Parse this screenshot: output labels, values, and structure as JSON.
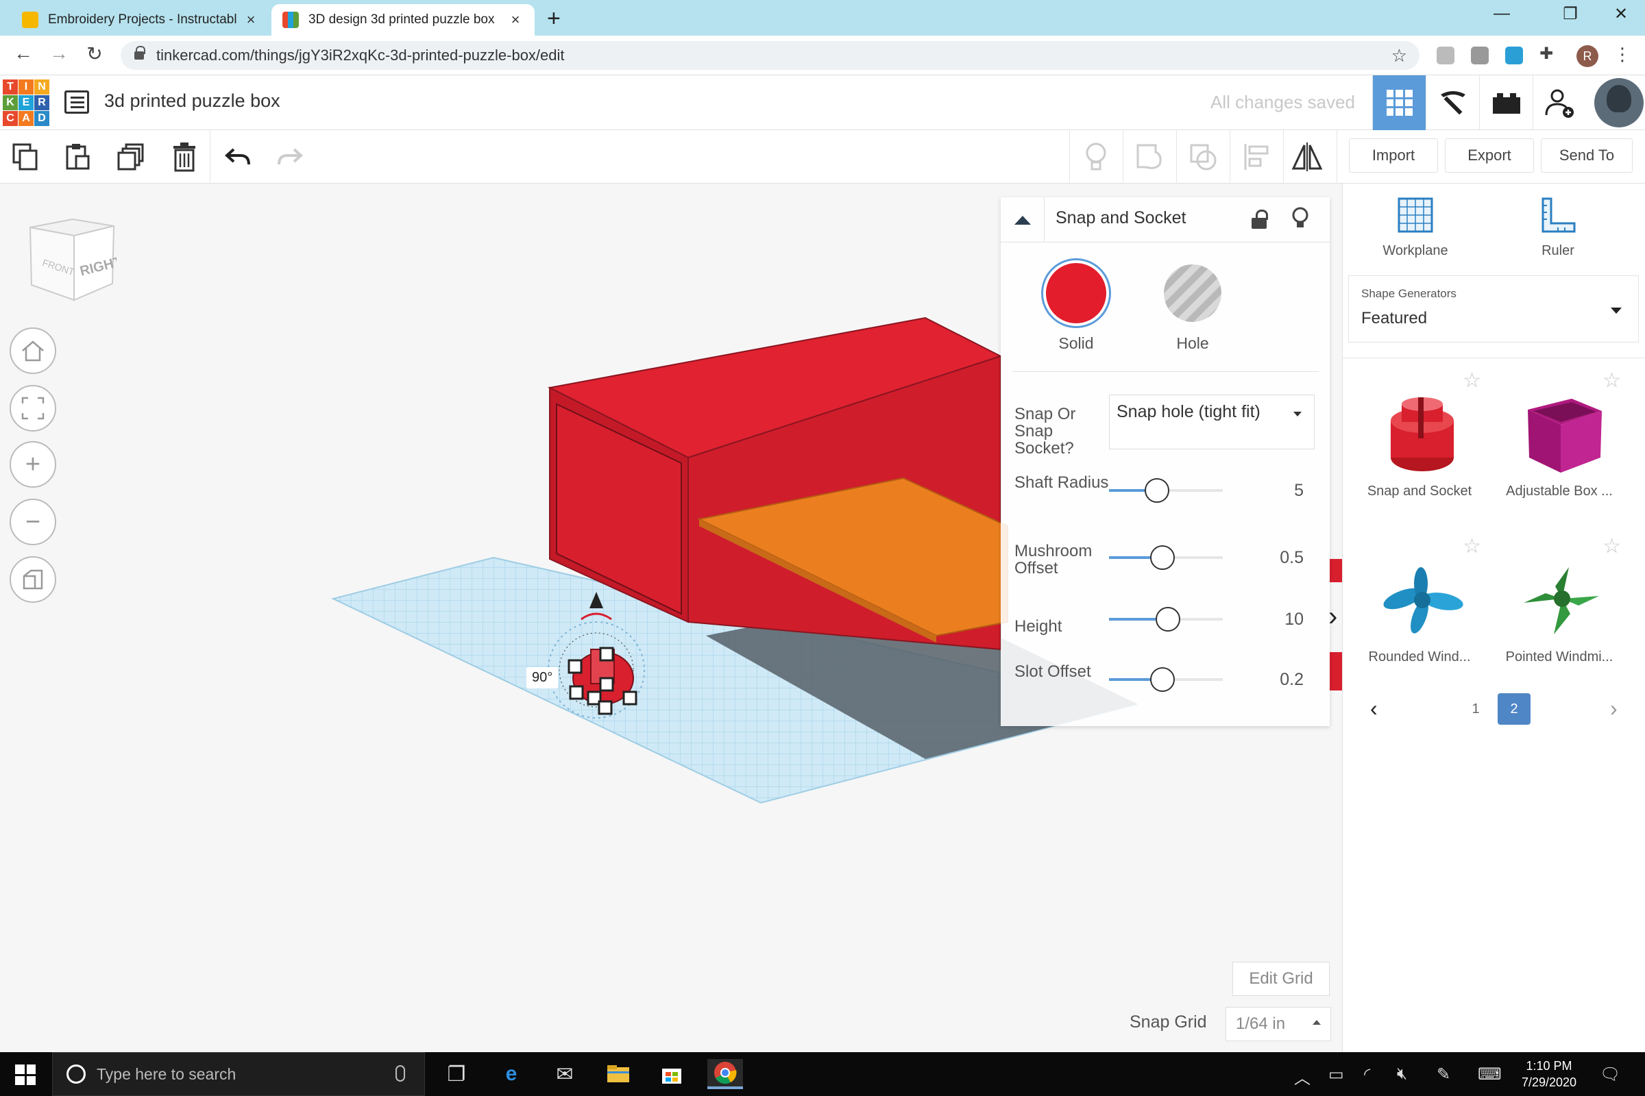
{
  "browser": {
    "tabs": [
      {
        "title": "Embroidery Projects - Instructabl",
        "active": false
      },
      {
        "title": "3D design 3d printed puzzle box",
        "active": true
      }
    ],
    "new_tab": "+",
    "url": "tinkercad.com/things/jgY3iR2xqKc-3d-printed-puzzle-box/edit",
    "profile_initial": "R",
    "window_controls": {
      "minimize": "—",
      "maximize": "❐",
      "close": "✕"
    }
  },
  "app": {
    "logo_letters": [
      "T",
      "I",
      "N",
      "K",
      "E",
      "R",
      "C",
      "A",
      "D"
    ],
    "logo_colors": [
      "#e8492c",
      "#f47a20",
      "#f4a91e",
      "#5e9e3a",
      "#20a3d8",
      "#2f62ae",
      "#e8492c",
      "#f47a20",
      "#2b8ac8"
    ],
    "project_name": "3d printed puzzle box",
    "save_status": "All changes saved"
  },
  "toolbar": {
    "import_label": "Import",
    "export_label": "Export",
    "send_to_label": "Send To"
  },
  "viewcube": {
    "front": "FRONT",
    "right": "RIGHT"
  },
  "viewport": {
    "rotation_label": "90°",
    "edit_grid_label": "Edit Grid",
    "snap_grid_label": "Snap Grid",
    "snap_grid_value": "1/64 in"
  },
  "inspector": {
    "title": "Snap and Socket",
    "solid_label": "Solid",
    "hole_label": "Hole",
    "solid_color": "#e31d2b",
    "props": {
      "type_label": "Snap Or Snap Socket?",
      "type_value": "Snap hole (tight fit)",
      "shaft_label": "Shaft Radius",
      "shaft_value": "5",
      "mushroom_label": "Mushroom Offset",
      "mushroom_value": "0.5",
      "height_label": "Height",
      "height_value": "10",
      "slot_label": "Slot Offset",
      "slot_value": "0.2"
    }
  },
  "sidebar": {
    "workplane_label": "Workplane",
    "ruler_label": "Ruler",
    "generators_heading": "Shape Generators",
    "generators_value": "Featured",
    "shapes": [
      {
        "label": "Snap and Socket"
      },
      {
        "label": "Adjustable Box ..."
      },
      {
        "label": "Rounded Wind..."
      },
      {
        "label": "Pointed Windmi..."
      }
    ],
    "pager": {
      "prev": "‹",
      "next": "›",
      "pages": [
        "1",
        "2"
      ],
      "current": "2"
    }
  },
  "taskbar": {
    "search_placeholder": "Type here to search",
    "time": "1:10 PM",
    "date": "7/29/2020"
  }
}
